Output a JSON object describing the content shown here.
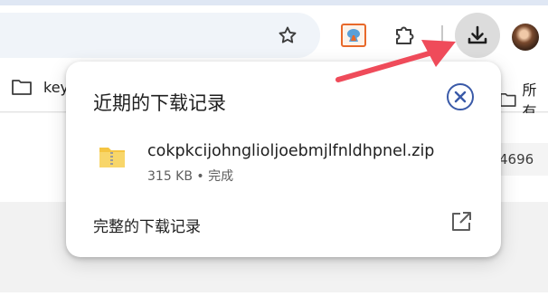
{
  "bookmarks": {
    "left_label": "key",
    "right_label": "所有"
  },
  "page": {
    "chip_text": "4696"
  },
  "downloads_popup": {
    "title": "近期的下载记录",
    "items": [
      {
        "file_name": "cokpkcijohnglioljoebmjlfnldhpnel.zip",
        "size": "315 KB",
        "separator": "•",
        "status": "完成"
      }
    ],
    "all_downloads_label": "完整的下载记录"
  },
  "colors": {
    "accent_blue": "#3a5aa8",
    "annotation_arrow": "#ef4b5a",
    "download_button_bg": "#dcdcdc"
  }
}
